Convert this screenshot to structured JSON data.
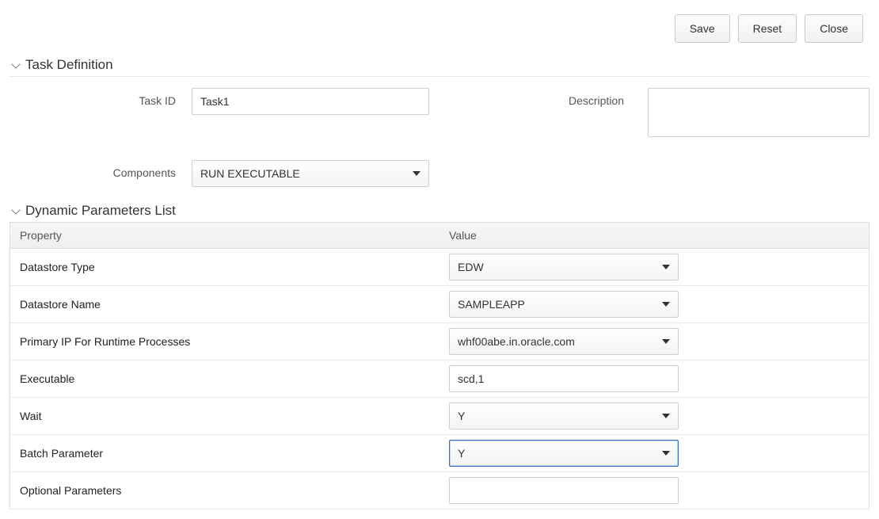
{
  "toolbar": {
    "save_label": "Save",
    "reset_label": "Reset",
    "close_label": "Close"
  },
  "task_def": {
    "title": "Task Definition",
    "task_id_label": "Task ID",
    "task_id_value": "Task1",
    "description_label": "Description",
    "description_value": "",
    "components_label": "Components",
    "components_value": "RUN EXECUTABLE"
  },
  "params": {
    "title": "Dynamic Parameters List",
    "col_property": "Property",
    "col_value": "Value",
    "rows": [
      {
        "property": "Datastore Type",
        "value": "EDW",
        "type": "select"
      },
      {
        "property": "Datastore Name",
        "value": "SAMPLEAPP",
        "type": "select"
      },
      {
        "property": "Primary IP For Runtime Processes",
        "value": "whf00abe.in.oracle.com",
        "type": "select"
      },
      {
        "property": "Executable",
        "value": "scd,1",
        "type": "text"
      },
      {
        "property": "Wait",
        "value": "Y",
        "type": "select"
      },
      {
        "property": "Batch Parameter",
        "value": "Y",
        "type": "select",
        "focused": true
      },
      {
        "property": "Optional Parameters",
        "value": "",
        "type": "text"
      }
    ]
  }
}
